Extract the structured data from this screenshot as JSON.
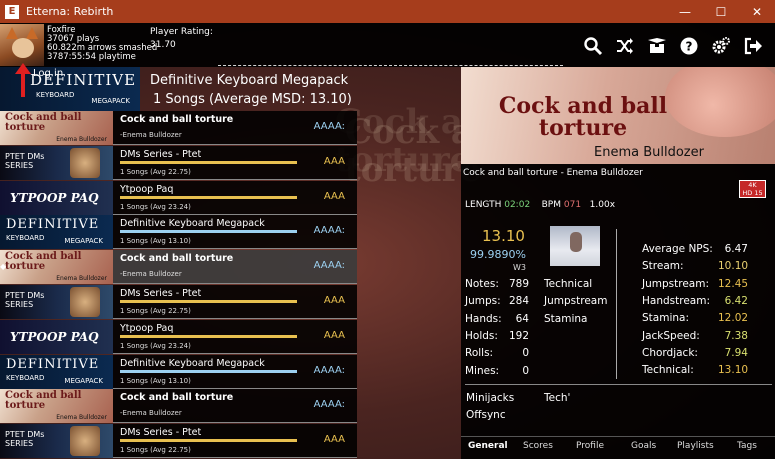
{
  "window": {
    "icon_letter": "E",
    "title": "Etterna: Rebirth",
    "minimize": "—",
    "maximize": "☐",
    "close": "✕"
  },
  "profile": {
    "name": "Foxfire",
    "plays": "37067 plays",
    "arrows": "60.822m arrows smashed",
    "playtime": "3787:55:54 playtime",
    "rating_label": "Player Rating:",
    "rating_value": "31.70",
    "login": "Log in"
  },
  "header_icons": [
    "search-icon",
    "shuffle-icon",
    "package-icon",
    "help-icon",
    "settings-icon",
    "exit-icon"
  ],
  "group": {
    "title": "Definitive Keyboard Megapack",
    "subtitle": "1 Songs (Average MSD: 13.10)",
    "banner_title": "DEFINITIVE",
    "banner_sub1": "KEYBOARD",
    "banner_sub2": "MEGAPACK"
  },
  "list": [
    {
      "kind": "song",
      "thumb": "cock",
      "title": "Cock and ball torture",
      "sub": "-Enema Bulldozer",
      "grade": "AAAA:",
      "grade_color": "blue"
    },
    {
      "kind": "pack",
      "thumb": "dms",
      "title": "DMs Series - Ptet",
      "sub": "1 Songs (Avg 22.75)",
      "grade": "AAA",
      "grade_color": "gold"
    },
    {
      "kind": "pack",
      "thumb": "ytp",
      "title": "Ytpoop Paq",
      "sub": "1 Songs (Avg 23.24)",
      "grade": "AAA",
      "grade_color": "gold"
    },
    {
      "kind": "pack",
      "thumb": "def",
      "title": "Definitive Keyboard Megapack",
      "sub": "1 Songs (Avg 13.10)",
      "grade": "AAAA:",
      "grade_color": "blue"
    },
    {
      "kind": "song",
      "thumb": "cock",
      "title": "Cock and ball torture",
      "sub": "-Enema Bulldozer",
      "grade": "AAAA:",
      "grade_color": "blue",
      "selected": true
    },
    {
      "kind": "pack",
      "thumb": "dms",
      "title": "DMs Series - Ptet",
      "sub": "1 Songs (Avg 22.75)",
      "grade": "AAA",
      "grade_color": "gold"
    },
    {
      "kind": "pack",
      "thumb": "ytp",
      "title": "Ytpoop Paq",
      "sub": "1 Songs (Avg 23.24)",
      "grade": "AAA",
      "grade_color": "gold"
    },
    {
      "kind": "pack",
      "thumb": "def",
      "title": "Definitive Keyboard Megapack",
      "sub": "1 Songs (Avg 13.10)",
      "grade": "AAAA:",
      "grade_color": "blue"
    },
    {
      "kind": "song",
      "thumb": "cock",
      "title": "Cock and ball torture",
      "sub": "-Enema Bulldozer",
      "grade": "AAAA:",
      "grade_color": "blue"
    },
    {
      "kind": "pack",
      "thumb": "dms",
      "title": "DMs Series - Ptet",
      "sub": "1 Songs (Avg 22.75)",
      "grade": "AAA",
      "grade_color": "gold"
    }
  ],
  "thumbs": {
    "cock_title": "Cock and ball torture",
    "cock_artist": "Enema Bulldozer",
    "dms_text": "PTET DMs SERIES",
    "ytp_text": "YTPOOP PAQ",
    "def_title": "DEFINITIVE",
    "def_sub1": "KEYBOARD",
    "def_sub2": "MEGAPACK"
  },
  "selection_marker": "◆",
  "song": {
    "banner_title": "Cock and ball torture",
    "banner_artist": "Enema Bulldozer",
    "line": "Cock and ball torture - Enema Bulldozer",
    "badge_top": "4K",
    "badge_bottom": "HD 15",
    "length_label": "LENGTH",
    "length_value": "02:02",
    "bpm_label": "BPM",
    "bpm_value": "071",
    "rate": "1.00x",
    "msd": "13.10",
    "score_pct": "99.9890%",
    "judge": "W3"
  },
  "counts": [
    {
      "label": "Notes:",
      "value": "789"
    },
    {
      "label": "Jumps:",
      "value": "284"
    },
    {
      "label": "Hands:",
      "value": "64"
    },
    {
      "label": "Holds:",
      "value": "192"
    },
    {
      "label": "Rolls:",
      "value": "0"
    },
    {
      "label": "Mines:",
      "value": "0"
    }
  ],
  "tags": [
    "Technical",
    "Jumpstream",
    "Stamina"
  ],
  "skillsets": [
    {
      "label": "Average NPS:",
      "value": "6.47",
      "color": "#ffffff"
    },
    {
      "label": "Stream:",
      "value": "10.10",
      "color": "#e8d070"
    },
    {
      "label": "Jumpstream:",
      "value": "12.45",
      "color": "#e8c050"
    },
    {
      "label": "Handstream:",
      "value": "6.42",
      "color": "#d8e070"
    },
    {
      "label": "Stamina:",
      "value": "12.02",
      "color": "#e8c050"
    },
    {
      "label": "JackSpeed:",
      "value": "7.38",
      "color": "#d8e070"
    },
    {
      "label": "Chordjack:",
      "value": "7.94",
      "color": "#d8e070"
    },
    {
      "label": "Technical:",
      "value": "13.10",
      "color": "#e8c050"
    }
  ],
  "extra": {
    "minijacks": "Minijacks",
    "offsync": "Offsync",
    "tech": "Tech'"
  },
  "tabs": [
    "General",
    "Scores",
    "Profile",
    "Goals",
    "Playlists",
    "Tags"
  ]
}
